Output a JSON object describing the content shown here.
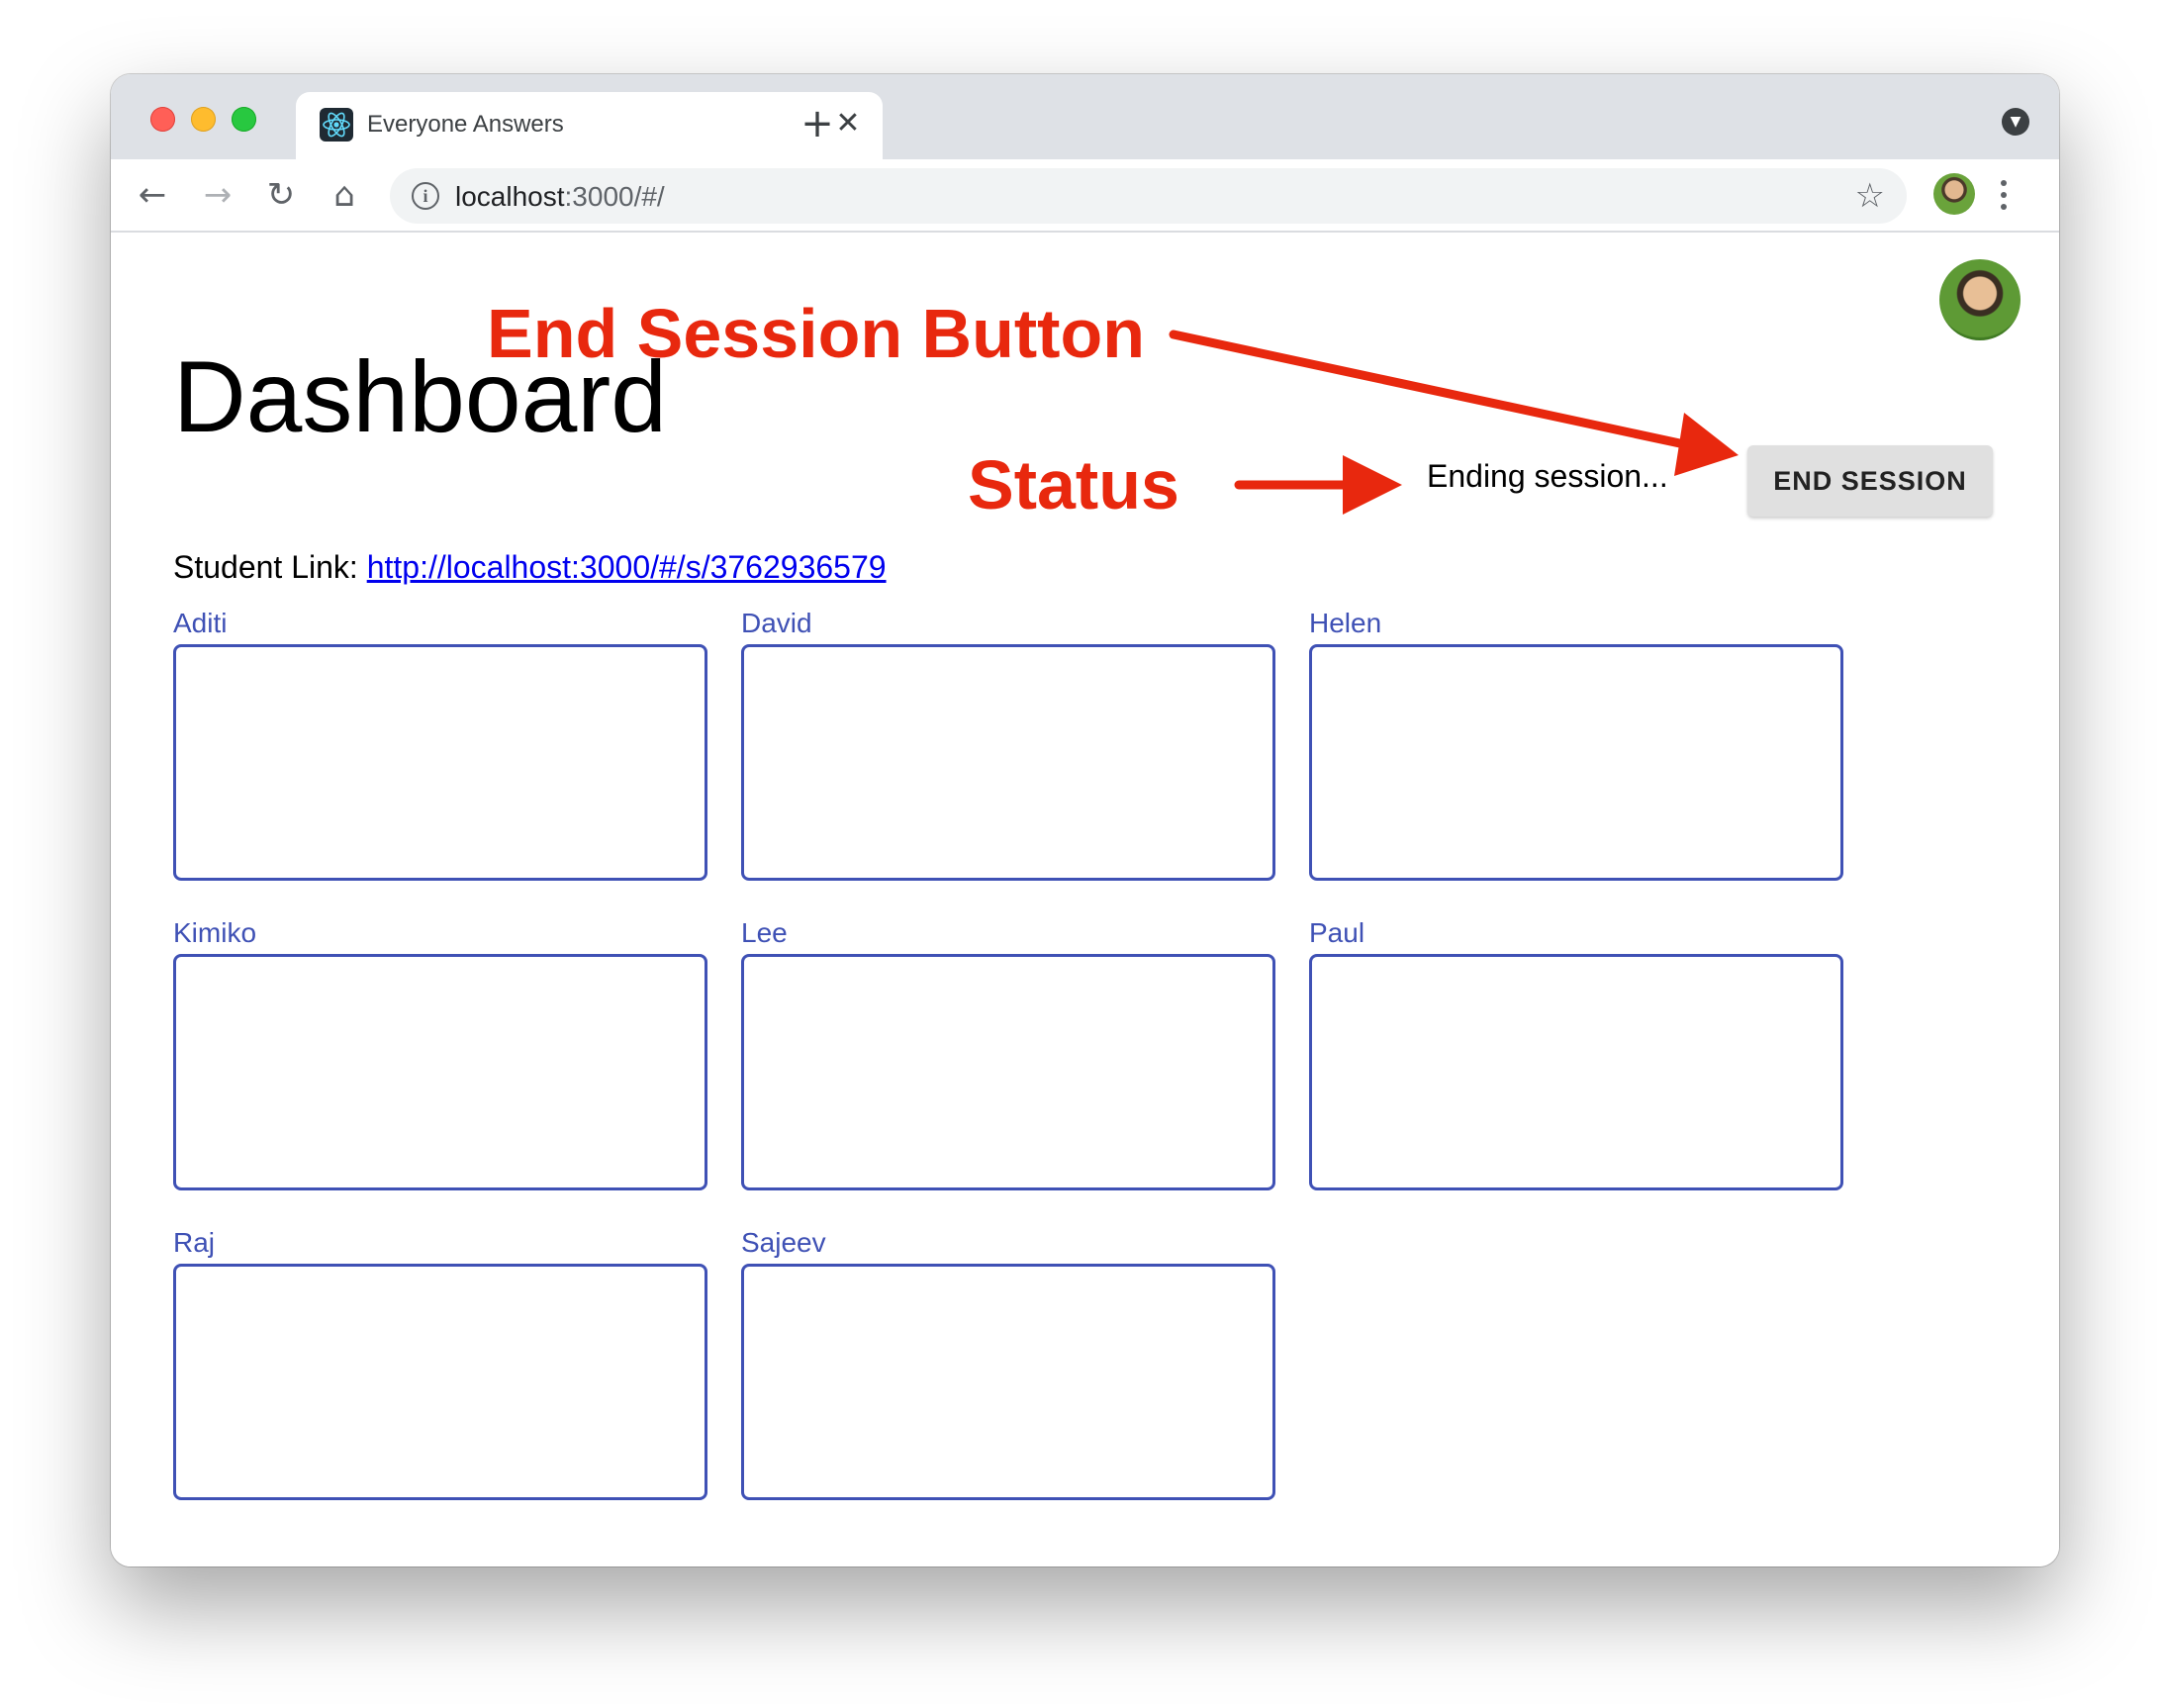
{
  "browser": {
    "tab_title": "Everyone Answers",
    "tab_close_glyph": "✕",
    "new_tab_glyph": "+",
    "url_host": "localhost",
    "url_path": ":3000/#/",
    "back_glyph": "←",
    "forward_glyph": "→",
    "reload_glyph": "↻",
    "home_glyph": "⌂",
    "star_glyph": "☆",
    "info_glyph": "i",
    "tabmenu_glyph": "▼"
  },
  "page": {
    "title": "Dashboard",
    "status": "Ending session...",
    "end_button_label": "END SESSION",
    "student_link_label": "Student Link: ",
    "student_link_url": "http://localhost:3000/#/s/3762936579"
  },
  "students": [
    "Aditi",
    "David",
    "Helen",
    "Kimiko",
    "Lee",
    "Paul",
    "Raj",
    "Sajeev"
  ],
  "annotations": {
    "end_session_button": "End Session Button",
    "status": "Status",
    "color": "#e8280e"
  },
  "colors": {
    "accent": "#3f51b5",
    "link": "#0000ee",
    "button_bg": "#e0e0e0",
    "chrome_frame": "#dee1e6"
  }
}
